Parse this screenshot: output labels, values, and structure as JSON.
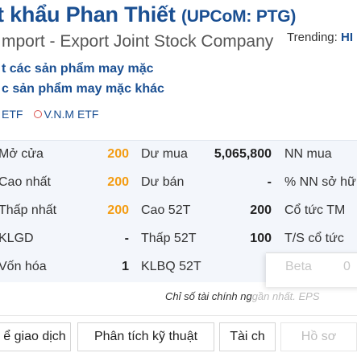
{
  "header": {
    "title_main": "t khẩu Phan Thiết",
    "title_ticker": "(UPCoM: PTG)",
    "subtitle": "mport - Export Joint Stock Company",
    "trending_label": "Trending:",
    "trending_ticker": "HI",
    "industry_1": "t các sản phẩm may mặc",
    "industry_2": "c sản phẩm may mặc khác",
    "etfs": [
      "ETF",
      "V.N.M ETF"
    ]
  },
  "stats": {
    "rows": [
      {
        "c1_label": "Mở cửa",
        "c1_value": "200",
        "c2_label": "Dư mua",
        "c2_value": "5,065,800",
        "c3_label": "NN mua"
      },
      {
        "c1_label": "Cao nhất",
        "c1_value": "200",
        "c2_label": "Dư bán",
        "c2_value": "-",
        "c3_label": "% NN sở hữ"
      },
      {
        "c1_label": "Thấp nhất",
        "c1_value": "200",
        "c2_label": "Cao 52T",
        "c2_value": "200",
        "c3_label": "Cổ tức TM"
      },
      {
        "c1_label": "KLGD",
        "c1_value": "-",
        "c2_label": "Thấp 52T",
        "c2_value": "100",
        "c3_label": "T/S cổ tức"
      },
      {
        "c1_label": "Vốn hóa",
        "c1_value": "1",
        "c2_label": "KLBQ 52T",
        "c2_value": ""
      }
    ],
    "popup_label": "Beta",
    "popup_value": "0",
    "note": "Chỉ số tài chính ng",
    "note_faded": "gần nhất. EPS"
  },
  "tabs": [
    {
      "label": "ể giao dịch"
    },
    {
      "label": "Phân tích kỹ thuật"
    },
    {
      "label": "Tài ch"
    },
    {
      "label": "Hồ sơ"
    }
  ]
}
